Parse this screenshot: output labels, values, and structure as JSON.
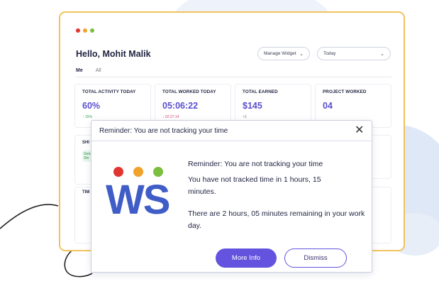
{
  "colors": {
    "accent": "#6353de",
    "logo_blue": "#3f5cc7",
    "dot_red": "#e1352f",
    "dot_orange": "#f0a22a",
    "dot_green": "#7cbe3f",
    "frame_border": "#f1c25b"
  },
  "dashboard": {
    "greeting": "Hello, Mohit Malik",
    "manage_widget": "Manage Widget",
    "date_filter": "Today",
    "tabs": [
      "Me",
      "All"
    ],
    "stats": [
      {
        "label": "TOTAL ACTIVITY TODAY",
        "value": "60%",
        "sub": "↑ 15%"
      },
      {
        "label": "TOTAL WORKED TODAY",
        "value": "05:06:22",
        "sub": "↓ 02:27:14"
      },
      {
        "label": "TOTAL EARNED",
        "value": "$145",
        "sub": "+$"
      },
      {
        "label": "PROJECT WORKED",
        "value": "04",
        "sub": ""
      }
    ],
    "partial": {
      "shift": "SHI",
      "green1": "Gene",
      "green2": "Shi",
      "time": "TIM"
    }
  },
  "modal": {
    "header": "Reminder: You are not tracking your time",
    "title": "Reminder: You are not tracking your time",
    "message1": "You have not tracked time in 1 hours, 15 minutes.",
    "message2": "There are 2 hours, 05 minutes remaining in your work day.",
    "logo_text": "WS",
    "more_info": "More Info",
    "dismiss": "Dismiss",
    "close_icon": "close-icon"
  }
}
